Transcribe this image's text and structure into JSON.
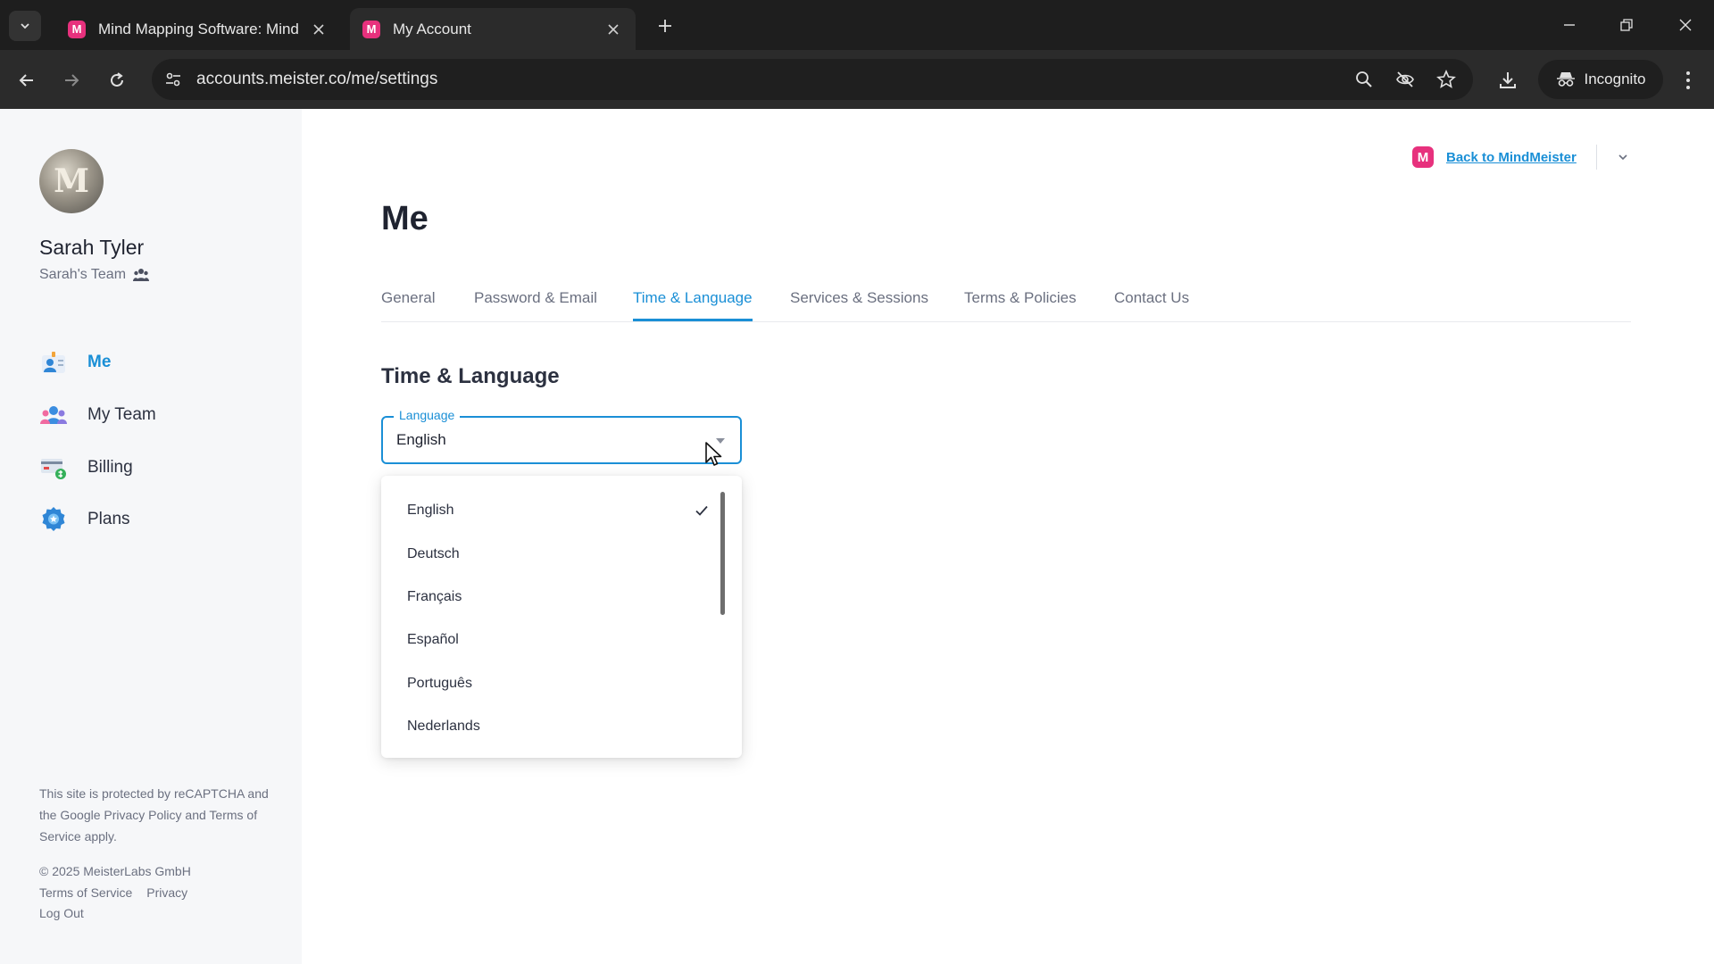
{
  "browser": {
    "tabs": [
      {
        "title": "Mind Mapping Software: Mind",
        "favicon": "M"
      },
      {
        "title": "My Account",
        "favicon": "M"
      }
    ],
    "url": "accounts.meister.co/me/settings",
    "incognito_label": "Incognito"
  },
  "sidebar": {
    "user_name": "Sarah Tyler",
    "team_name": "Sarah's Team",
    "items": [
      {
        "label": "Me",
        "icon": "profile-card-icon",
        "active": true
      },
      {
        "label": "My Team",
        "icon": "team-icon"
      },
      {
        "label": "Billing",
        "icon": "billing-icon"
      },
      {
        "label": "Plans",
        "icon": "badge-icon"
      }
    ],
    "recaptcha_note": "This site is protected by reCAPTCHA and the Google Privacy Policy and Terms of Service apply.",
    "copyright": "© 2025 MeisterLabs GmbH",
    "terms_link": "Terms of Service",
    "privacy_link": "Privacy",
    "logout": "Log Out"
  },
  "header": {
    "back_link": "Back to MindMeister",
    "logo_letter": "M"
  },
  "main": {
    "title": "Me",
    "tabs": [
      {
        "label": "General"
      },
      {
        "label": "Password & Email"
      },
      {
        "label": "Time & Language",
        "active": true
      },
      {
        "label": "Services & Sessions"
      },
      {
        "label": "Terms & Policies"
      },
      {
        "label": "Contact Us"
      }
    ],
    "section_title": "Time & Language",
    "language_select": {
      "label": "Language",
      "value": "English",
      "options": [
        "English",
        "Deutsch",
        "Français",
        "Español",
        "Português",
        "Nederlands"
      ],
      "selected": "English"
    }
  },
  "colors": {
    "accent": "#1a8fd6",
    "brand": "#e7317d",
    "chrome_dark": "#1e1e1e"
  }
}
